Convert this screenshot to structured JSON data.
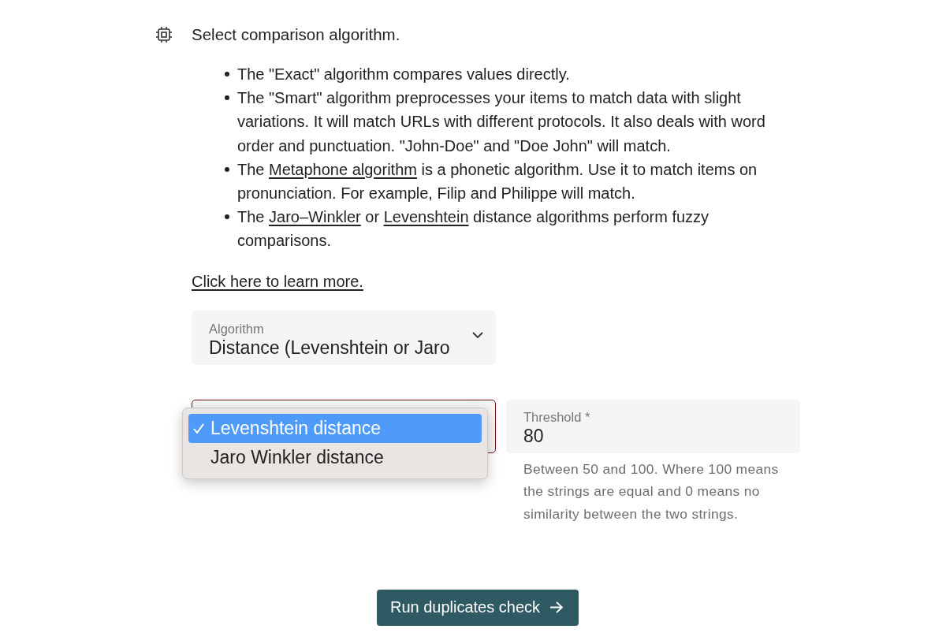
{
  "header": {
    "title": "Select comparison algorithm."
  },
  "bullets": [
    {
      "segments": [
        {
          "kind": "text",
          "text": "The \"Exact\" algorithm compares values directly."
        }
      ]
    },
    {
      "segments": [
        {
          "kind": "text",
          "text": "The \"Smart\" algorithm preprocesses your items to match data with slight variations. It will match URLs with different protocols. It also deals with word order and punctuation. \"John-Doe\" and \"Doe John\" will match."
        }
      ]
    },
    {
      "segments": [
        {
          "kind": "text",
          "text": "The "
        },
        {
          "kind": "link",
          "text": "Metaphone algorithm"
        },
        {
          "kind": "text",
          "text": " is a phonetic algorithm. Use it to match items on pronunciation. For example, Filip and Philippe will match."
        }
      ]
    },
    {
      "segments": [
        {
          "kind": "text",
          "text": "The "
        },
        {
          "kind": "link",
          "text": "Jaro–Winkler"
        },
        {
          "kind": "text",
          "text": " or "
        },
        {
          "kind": "link",
          "text": "Levenshtein"
        },
        {
          "kind": "text",
          "text": " distance algorithms perform fuzzy comparisons."
        }
      ]
    }
  ],
  "learn_more_link": {
    "text": "Click here to learn more."
  },
  "algorithm_select": {
    "label": "Algorithm",
    "value": "Distance (Levenshtein or Jaro"
  },
  "distance_select": {
    "focused": true,
    "menu": [
      {
        "label": "Levenshtein distance",
        "selected": true
      },
      {
        "label": "Jaro Winkler distance",
        "selected": false
      }
    ]
  },
  "threshold_field": {
    "label": "Threshold *",
    "value": "80",
    "helper": "Between 50 and 100. Where 100 means the strings are equal and 0 means no similarity between the two strings."
  },
  "run_button": {
    "label": "Run duplicates check"
  }
}
